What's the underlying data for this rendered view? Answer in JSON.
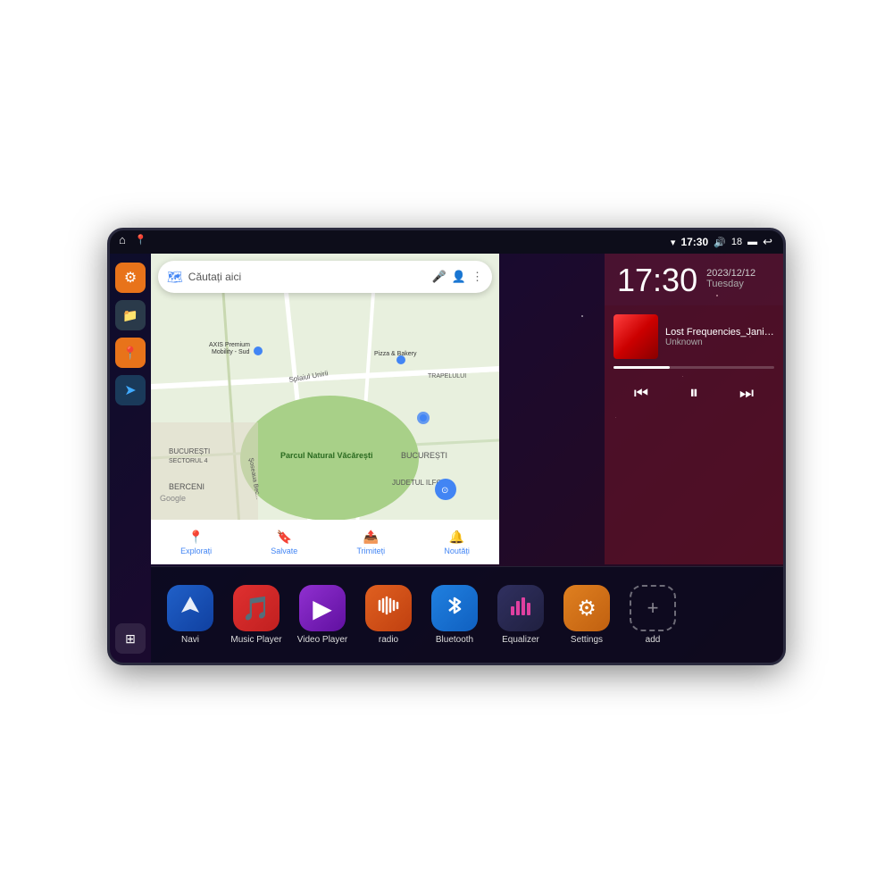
{
  "device": {
    "status_bar": {
      "nav_home": "⌂",
      "nav_location": "📍",
      "wifi_icon": "▾",
      "time": "17:30",
      "volume_icon": "🔊",
      "battery_level": "18",
      "battery_icon": "🔋",
      "back_icon": "↩"
    },
    "sidebar": {
      "items": [
        {
          "id": "settings",
          "icon": "⚙",
          "color": "orange",
          "label": "Settings"
        },
        {
          "id": "files",
          "icon": "📁",
          "color": "dark-teal",
          "label": "Files"
        },
        {
          "id": "map",
          "icon": "📍",
          "color": "orange",
          "label": "Map"
        },
        {
          "id": "navigation",
          "icon": "➤",
          "color": "nav-arrow",
          "label": "Navigation"
        }
      ],
      "grid_icon": "⊞"
    },
    "map": {
      "search_placeholder": "Căutați aici",
      "bottom_tabs": [
        {
          "id": "explore",
          "icon": "📍",
          "label": "Explorați"
        },
        {
          "id": "saved",
          "icon": "🔖",
          "label": "Salvate"
        },
        {
          "id": "share",
          "icon": "📤",
          "label": "Trimiteți"
        },
        {
          "id": "updates",
          "icon": "🔔",
          "label": "Noutăți"
        }
      ],
      "poi_labels": [
        "AXIS Premium Mobility - Sud",
        "Pizza & Bakery",
        "TRAPELULUI",
        "Parcul Natural Văcărești",
        "BUCUREȘTI",
        "BUCUREȘTI SECTORUL 4",
        "JUDETUL ILFOV",
        "BERCENI"
      ],
      "google_label": "Google"
    },
    "clock": {
      "time": "17:30",
      "date": "2023/12/12",
      "day": "Tuesday"
    },
    "music": {
      "track_title": "Lost Frequencies_Janie...",
      "artist": "Unknown",
      "progress_percent": 35,
      "controls": {
        "prev": "⏮",
        "pause": "⏸",
        "next": "⏭"
      }
    },
    "apps": [
      {
        "id": "navi",
        "label": "Navi",
        "icon": "➤",
        "bg": "bg-blue-nav"
      },
      {
        "id": "music-player",
        "label": "Music Player",
        "icon": "🎵",
        "bg": "bg-red-music"
      },
      {
        "id": "video-player",
        "label": "Video Player",
        "icon": "▶",
        "bg": "bg-purple-video"
      },
      {
        "id": "radio",
        "label": "radio",
        "icon": "📻",
        "bg": "bg-orange-radio"
      },
      {
        "id": "bluetooth",
        "label": "Bluetooth",
        "icon": "🔷",
        "bg": "bg-blue-bt"
      },
      {
        "id": "equalizer",
        "label": "Equalizer",
        "icon": "🎚",
        "bg": "bg-dark-eq"
      },
      {
        "id": "settings",
        "label": "Settings",
        "icon": "⚙",
        "bg": "bg-orange-settings"
      },
      {
        "id": "add",
        "label": "add",
        "icon": "+",
        "bg": "bg-gray-add"
      }
    ]
  }
}
